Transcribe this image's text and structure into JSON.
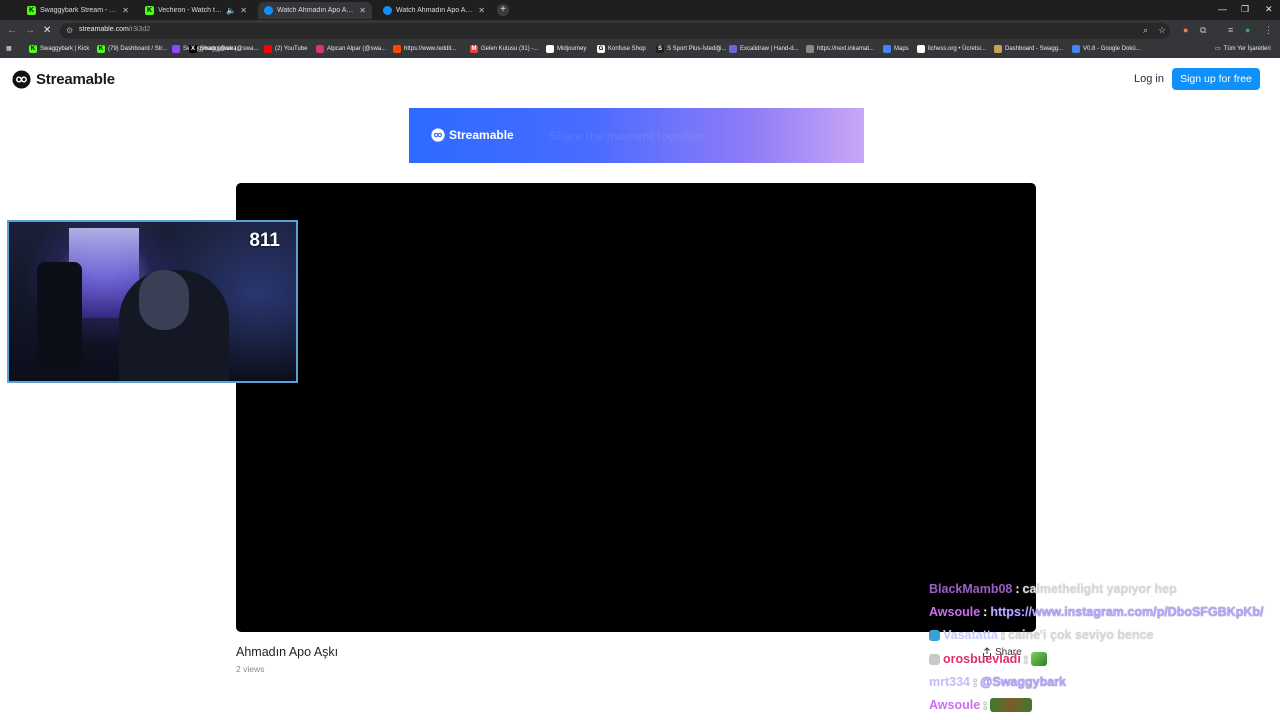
{
  "browser": {
    "tabs": [
      {
        "title": "Swaggybark Stream - Watch Li...",
        "color": "#53fc18",
        "letter": "K",
        "active": false
      },
      {
        "title": "Vechiron - Watch the VOD",
        "color": "#53fc18",
        "letter": "K",
        "active": false
      },
      {
        "title": "Watch Ahmadın Apo Aşkı | Stre...",
        "color": "#0f90fa",
        "letter": "",
        "active": true
      },
      {
        "title": "Watch Ahmadın Apo Aşkı | Stre...",
        "color": "#0f90fa",
        "letter": "",
        "active": false
      }
    ],
    "new_tab": "+",
    "url_host": "streamable.com",
    "url_path": "/r3i3d2",
    "bookmarks": [
      {
        "label": "Swaggybark | Kick",
        "color": "#53fc18",
        "letter": "K"
      },
      {
        "label": "(79) Dashboard / Str...",
        "color": "#53fc18",
        "letter": "K"
      },
      {
        "label": "Swaggybark (@swa...",
        "color": "#9146ff",
        "letter": ""
      },
      {
        "label": "Swaggybark (@swa...",
        "color": "#000000",
        "letter": "X"
      },
      {
        "label": "(2) YouTube",
        "color": "#ff0000",
        "letter": ""
      },
      {
        "label": "Alpcan Alpar (@swa...",
        "color": "#e1306c",
        "letter": ""
      },
      {
        "label": "https://www.reddit...",
        "color": "#ff4500",
        "letter": ""
      },
      {
        "label": "Gelen Kutusu (31) -...",
        "color": "#ea4335",
        "letter": "M"
      },
      {
        "label": "Midjourney",
        "color": "#ffffff",
        "letter": ""
      },
      {
        "label": "Konfuse Shop",
        "color": "#ffffff",
        "letter": "G"
      },
      {
        "label": "S Sport Plus-İstediği...",
        "color": "#1f1f1f",
        "letter": "S"
      },
      {
        "label": "Excalidraw | Hand-d...",
        "color": "#6965db",
        "letter": ""
      },
      {
        "label": "https://next.inkamat...",
        "color": "#888888",
        "letter": ""
      },
      {
        "label": "Maps",
        "color": "#4285f4",
        "letter": ""
      },
      {
        "label": "lichess.org • Ücretsi...",
        "color": "#ffffff",
        "letter": ""
      },
      {
        "label": "Dashboard - Swagg...",
        "color": "#c8a25a",
        "letter": ""
      },
      {
        "label": "V0.8 - Google Dokü...",
        "color": "#4285f4",
        "letter": ""
      }
    ],
    "all_bookmarks": "Tüm Yer İşaretleri"
  },
  "header": {
    "logo_text": "Streamable",
    "login": "Log in",
    "signup": "Sign up for free"
  },
  "banner": {
    "logo_text": "Streamable",
    "ghost_text": "Share the moment together"
  },
  "video": {
    "title": "Ahmadın Apo Aşkı",
    "views": "2 views",
    "share": "Share"
  },
  "overlay": {
    "counter": "811"
  },
  "chat": [
    {
      "user": "BlackMamb08",
      "text": "calmethelight yapıyor hep",
      "style": "faint",
      "user_color": "#9b5dc8",
      "badge": false
    },
    {
      "user": "Awsoule",
      "text": "https://www.instagram.com/p/DboSFGBKpKb/",
      "style": "link",
      "user_color": "#cd6ef2",
      "badge": false
    },
    {
      "user": "Vasatatta",
      "text": "caine'i çok seviyo bence",
      "style": "faint",
      "user_color": "#c7c7ff",
      "badge": true
    },
    {
      "user": "orosbuevladi",
      "text": "",
      "style": "emote",
      "user_color": "#e0306b",
      "badge": true
    },
    {
      "user": "mrt334",
      "text": "@Swaggybark",
      "style": "link",
      "user_color": "#c9b8ff",
      "badge": false
    },
    {
      "user": "Awsoule",
      "text": "",
      "style": "emote",
      "user_color": "#cd6ef2",
      "badge": false
    }
  ],
  "colors": {
    "accent": "#0f90fa",
    "webcam_border": "#5aa1d8"
  }
}
